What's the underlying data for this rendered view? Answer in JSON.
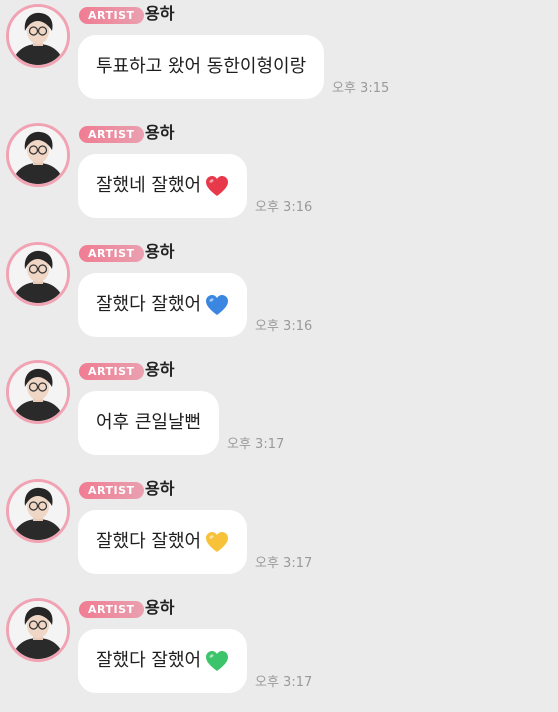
{
  "messages": [
    {
      "badge": "ARTIST",
      "name": "용하",
      "text": "투표하고 왔어 동한이형이랑",
      "emoji": null,
      "time": "오후 3:15"
    },
    {
      "badge": "ARTIST",
      "name": "용하",
      "text": "잘했네 잘했어",
      "emoji": "red-heart-icon",
      "time": "오후 3:16"
    },
    {
      "badge": "ARTIST",
      "name": "용하",
      "text": "잘했다 잘했어",
      "emoji": "blue-heart-icon",
      "time": "오후 3:16"
    },
    {
      "badge": "ARTIST",
      "name": "용하",
      "text": "어후 큰일날뻔",
      "emoji": null,
      "time": "오후 3:17"
    },
    {
      "badge": "ARTIST",
      "name": "용하",
      "text": "잘했다 잘했어",
      "emoji": "yellow-heart-icon",
      "time": "오후 3:17"
    },
    {
      "badge": "ARTIST",
      "name": "용하",
      "text": "잘했다 잘했어",
      "emoji": "green-heart-icon",
      "time": "오후 3:17"
    }
  ],
  "colors": {
    "background": "#ebebeb",
    "badge": "#f07c92",
    "avatar_ring": "#f1a3b3",
    "bubble": "#ffffff",
    "timestamp": "#9a9a9a",
    "red-heart-icon": "#e8394b",
    "blue-heart-icon": "#3a86e0",
    "yellow-heart-icon": "#f7c23a",
    "green-heart-icon": "#3cc46a"
  }
}
